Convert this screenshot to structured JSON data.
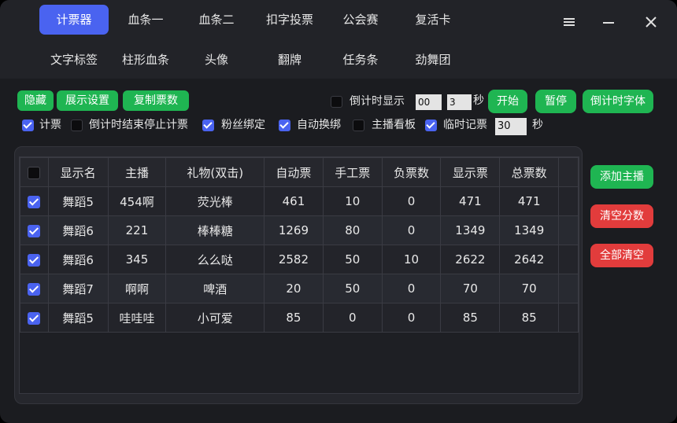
{
  "tabs_row1": [
    {
      "label": "计票器",
      "active": true
    },
    {
      "label": "血条一"
    },
    {
      "label": "血条二"
    },
    {
      "label": "扣字投票"
    },
    {
      "label": "公会赛"
    },
    {
      "label": "复活卡"
    }
  ],
  "tabs_row2": [
    {
      "label": "文字标签"
    },
    {
      "label": "柱形血条"
    },
    {
      "label": "头像"
    },
    {
      "label": "翻牌"
    },
    {
      "label": "任务条"
    },
    {
      "label": "劲舞团"
    }
  ],
  "window_controls": {
    "menu": "≡",
    "minimize": "—",
    "close": "✕"
  },
  "toolbar": {
    "hide": "隐藏",
    "display_settings": "展示设置",
    "copy_votes": "复制票数",
    "countdown_display": "倒计时显示",
    "countdown_min": "00",
    "countdown_sec": "3",
    "sec_unit": "秒",
    "start": "开始",
    "pause": "暂停",
    "countdown_font": "倒计时字体"
  },
  "options": {
    "count": "计票",
    "stop_on_countdown_end": "倒计时结束停止计票",
    "fan_binding": "粉丝绑定",
    "auto_swap": "自动换绑",
    "host_board": "主播看板",
    "temp_record": "临时记票",
    "temp_record_value": "30",
    "sec_unit": "秒"
  },
  "side_buttons": {
    "add_host": "添加主播",
    "clear_scores": "清空分数",
    "clear_all": "全部清空"
  },
  "table": {
    "headers": [
      "显示名",
      "主播",
      "礼物(双击)",
      "自动票",
      "手工票",
      "负票数",
      "显示票",
      "总票数"
    ],
    "rows": [
      {
        "checked": true,
        "cells": [
          "舞蹈5",
          "454啊",
          "荧光棒",
          "461",
          "10",
          "0",
          "471",
          "471"
        ]
      },
      {
        "checked": true,
        "cells": [
          "舞蹈6",
          "221",
          "棒棒糖",
          "1269",
          "80",
          "0",
          "1349",
          "1349"
        ]
      },
      {
        "checked": true,
        "cells": [
          "舞蹈6",
          "345",
          "么么哒",
          "2582",
          "50",
          "10",
          "2622",
          "2642"
        ]
      },
      {
        "checked": true,
        "cells": [
          "舞蹈7",
          "啊啊",
          "啤酒",
          "20",
          "50",
          "0",
          "70",
          "70"
        ]
      },
      {
        "checked": true,
        "cells": [
          "舞蹈5",
          "哇哇哇",
          "小可爱",
          "85",
          "0",
          "0",
          "85",
          "85"
        ]
      }
    ]
  },
  "colors": {
    "accent": "#4a63f0",
    "green": "#1fb552",
    "red": "#e23c3c",
    "background": "#1b1c20"
  }
}
